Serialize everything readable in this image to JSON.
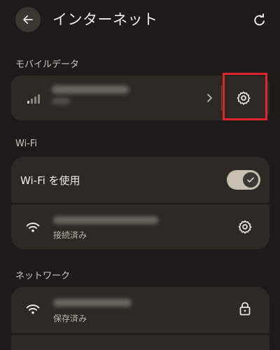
{
  "header": {
    "title": "インターネット",
    "back_icon": "arrow-left-icon",
    "action_icon": "refresh-icon"
  },
  "mobile_data": {
    "section_label": "モバイルデータ",
    "signal_icon": "signal-bars-icon",
    "chevron_icon": "chevron-right-icon",
    "settings_icon": "gear-icon"
  },
  "wifi": {
    "section_label": "Wi-Fi",
    "use_wifi_label": "Wi-Fi を使用",
    "toggle_state": true,
    "connected_status": "接続済み"
  },
  "network": {
    "section_label": "ネットワーク",
    "saved_status": "保存済み"
  },
  "colors": {
    "background": "#1c1b1a",
    "card": "#2d2a26",
    "highlight": "#e0252d",
    "toggle_track": "#c7bfb1"
  }
}
